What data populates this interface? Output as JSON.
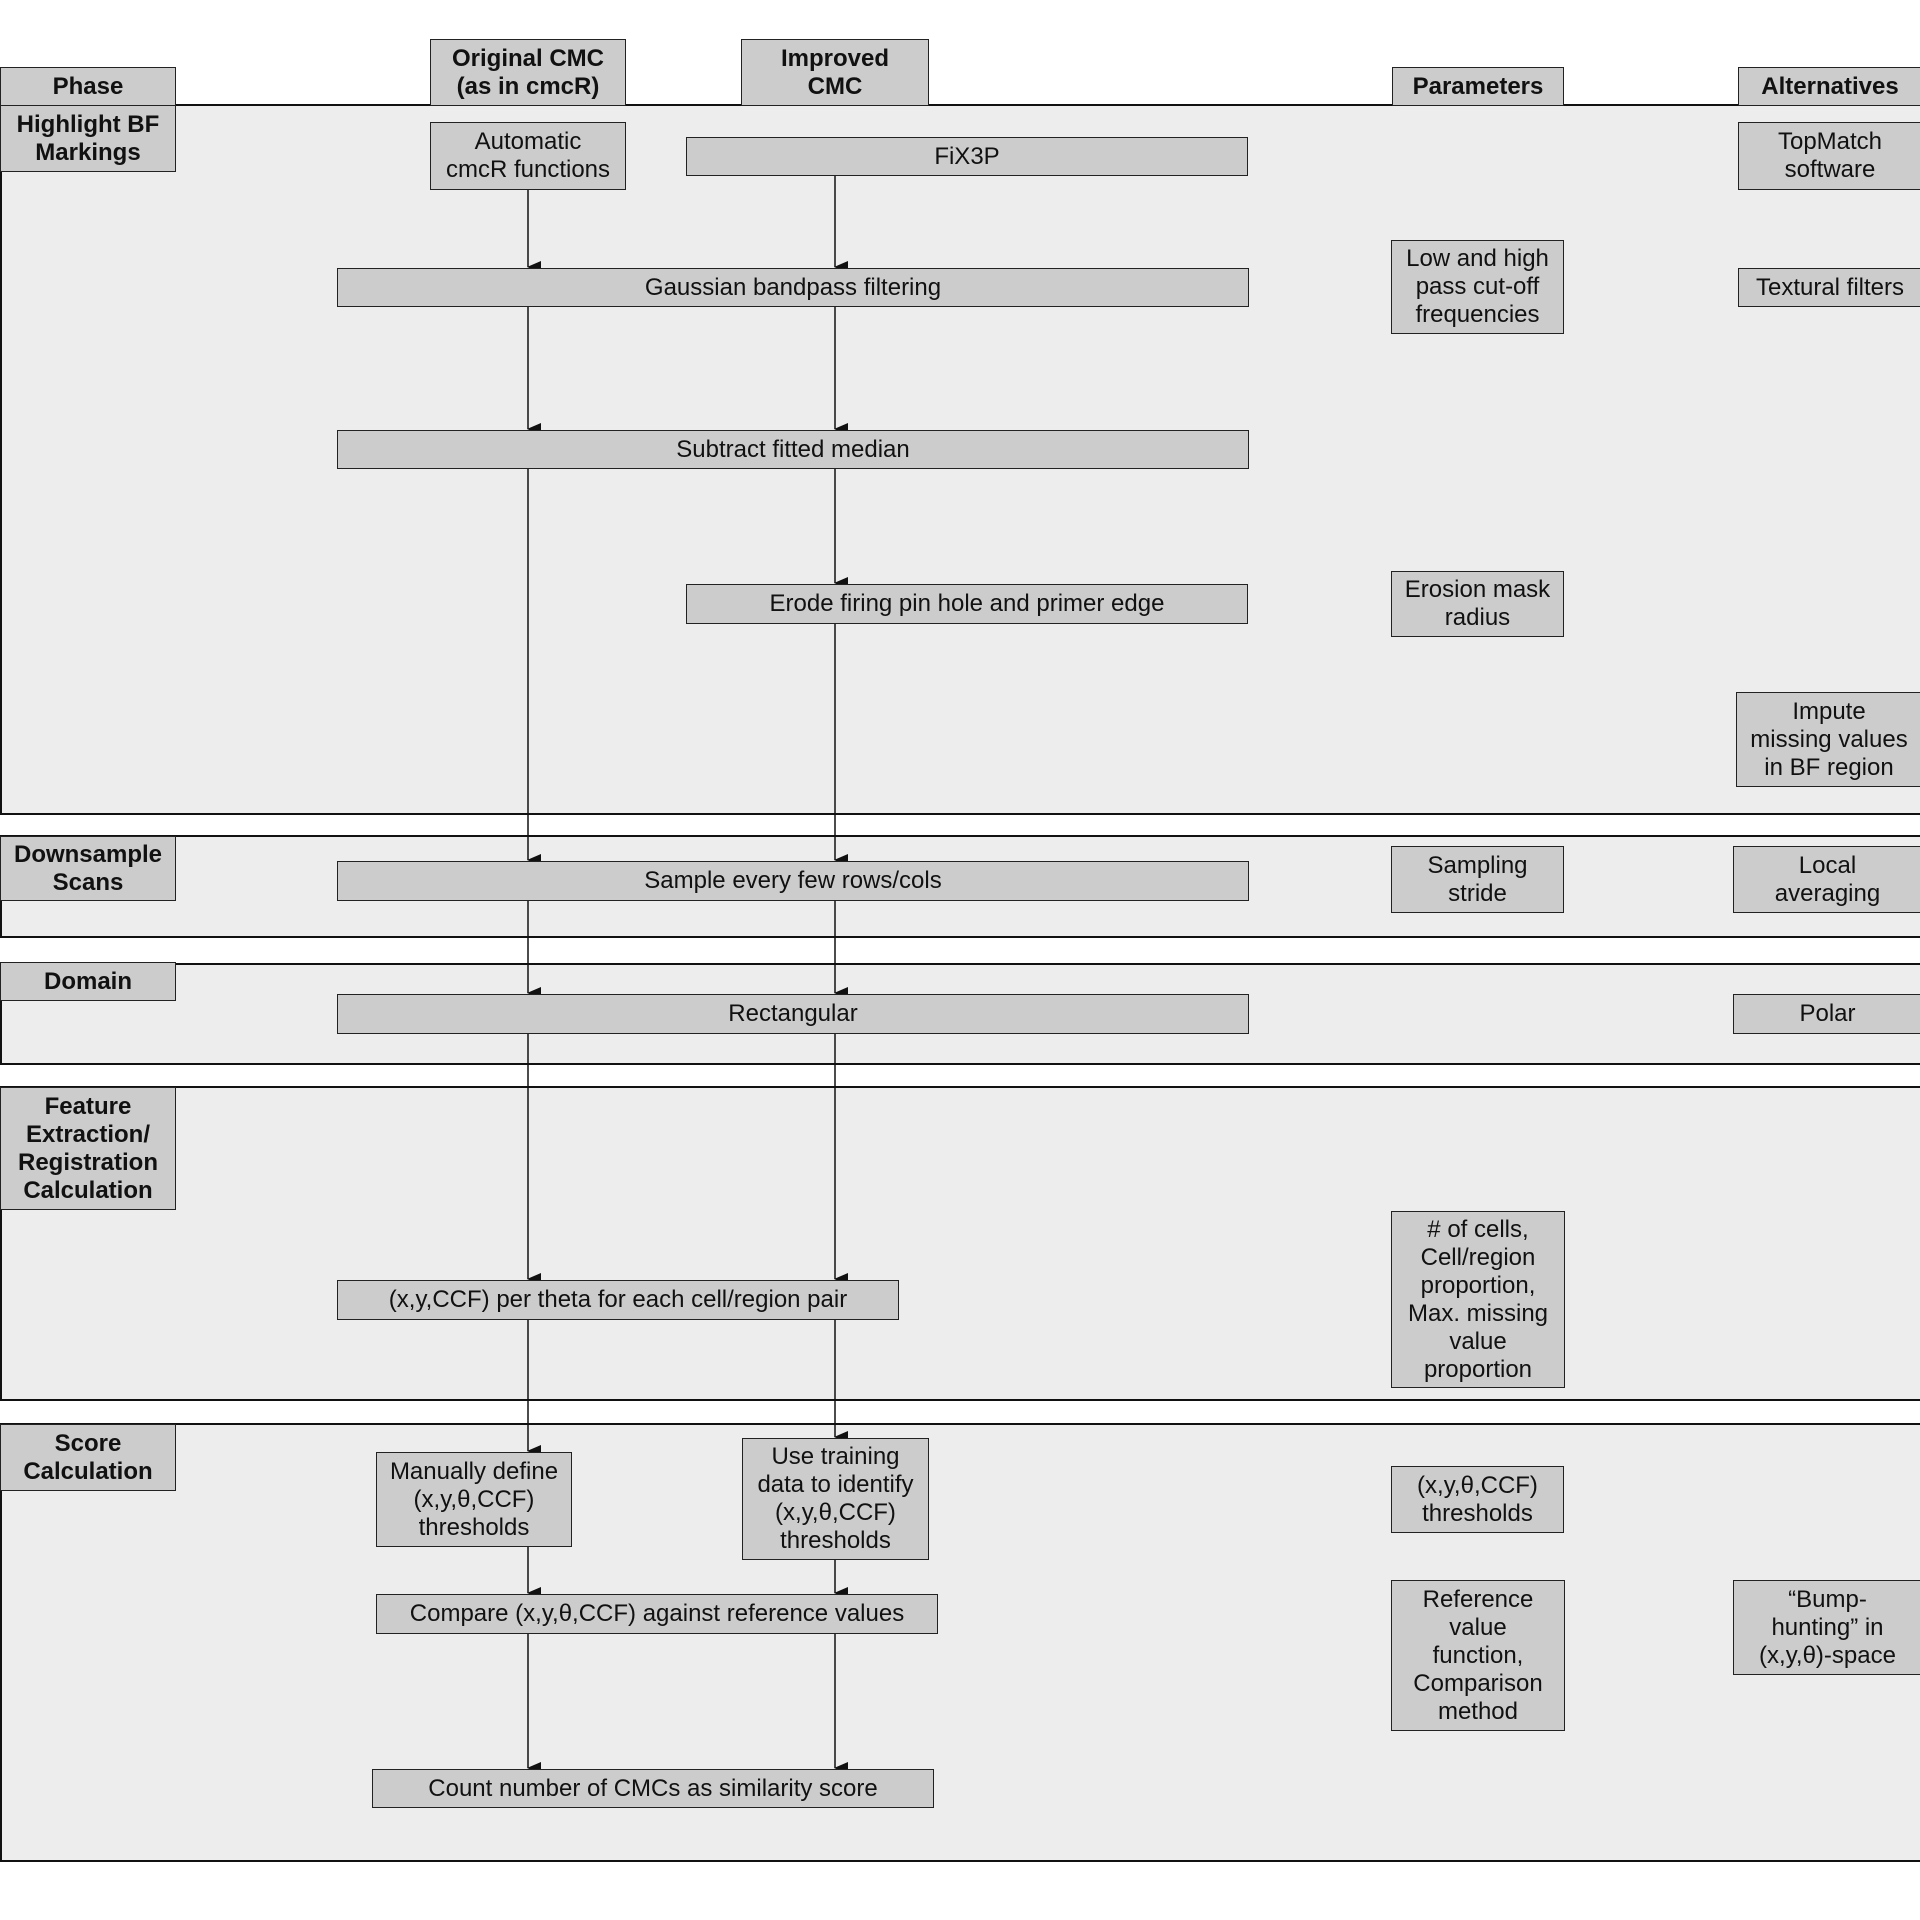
{
  "headers": {
    "phase": "Phase",
    "original": "Original CMC\n(as in cmcR)",
    "improved": "Improved\nCMC",
    "parameters": "Parameters",
    "alternatives": "Alternatives"
  },
  "phases": [
    {
      "label": "Highlight BF\nMarkings"
    },
    {
      "label": "Downsample\nScans"
    },
    {
      "label": "Domain"
    },
    {
      "label": "Feature\nExtraction/\nRegistration\nCalculation"
    },
    {
      "label": "Score\nCalculation"
    }
  ],
  "steps": {
    "automatic_cmcr": "Automatic\ncmcR functions",
    "fix3p": "FiX3P",
    "gaussian": "Gaussian bandpass filtering",
    "subtract_median": "Subtract fitted median",
    "erode": "Erode firing pin hole and primer edge",
    "sample": "Sample every few rows/cols",
    "rectangular": "Rectangular",
    "xyccf": "(x,y,CCF) per theta for each cell/region pair",
    "manual_thresholds": "Manually define\n(x,y,θ,CCF)\nthresholds",
    "training_thresholds": "Use training\ndata to identify\n(x,y,θ,CCF)\nthresholds",
    "compare": "Compare (x,y,θ,CCF) against reference values",
    "count": "Count number of CMCs as similarity score"
  },
  "parameters": {
    "cutoff": "Low and high\npass cut-off\nfrequencies",
    "erosion": "Erosion mask\nradius",
    "stride": "Sampling\nstride",
    "cells": "# of cells,\nCell/region\nproportion,\nMax. missing\nvalue\nproportion",
    "thresholds": "(x,y,θ,CCF)\nthresholds",
    "reference": "Reference\nvalue\nfunction,\nComparison\nmethod"
  },
  "alternatives": {
    "topmatch": "TopMatch\nsoftware",
    "textural": "Textural filters",
    "impute": "Impute\nmissing values\nin BF region",
    "local_avg": "Local\naveraging",
    "polar": "Polar",
    "bump": "“Bump-\nhunting” in\n(x,y,θ)-space"
  },
  "colors": {
    "band_fill": "#ededed",
    "box_fill": "#cccccc",
    "line": "#111111"
  }
}
